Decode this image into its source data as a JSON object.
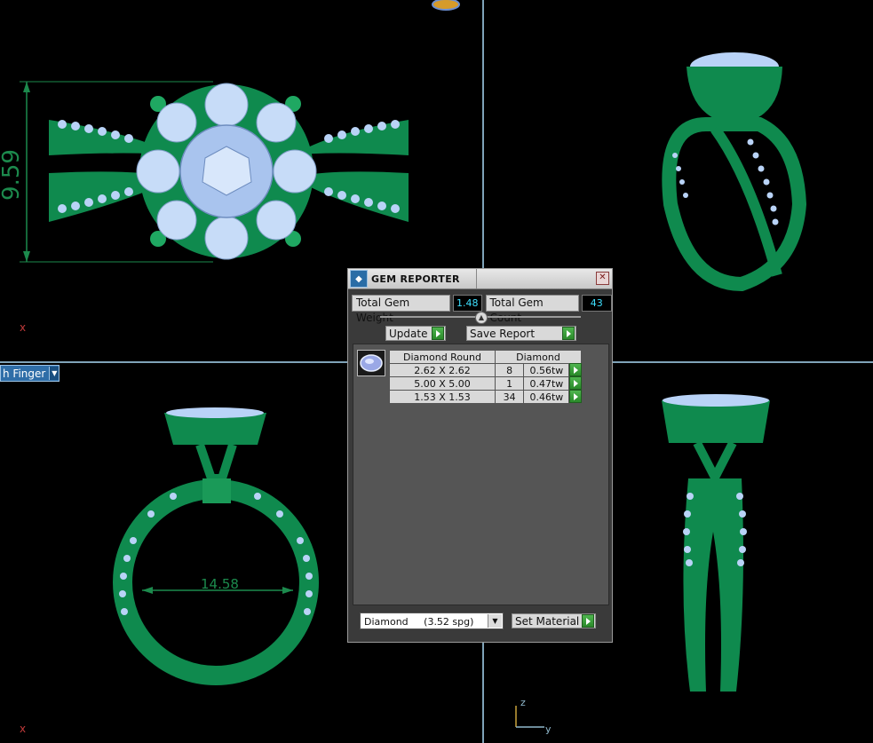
{
  "viewport": {
    "front_dimension": "9.59",
    "side_dimension": "14.58",
    "finger_selector": "h Finger",
    "axis_x": "x",
    "axis_z": "z",
    "axis_y": "y"
  },
  "panel": {
    "title": "GEM REPORTER",
    "total_weight_label": "Total Gem Weight",
    "total_weight_value": "1.48",
    "total_count_label": "Total Gem Count",
    "total_count_value": "43",
    "update_label": "Update",
    "save_report_label": "Save Report",
    "table_headers": [
      "Diamond Round",
      "Diamond"
    ],
    "rows": [
      {
        "size": "2.62 X 2.62",
        "count": "8",
        "weight": "0.56tw"
      },
      {
        "size": "5.00 X 5.00",
        "count": "1",
        "weight": "0.47tw"
      },
      {
        "size": "1.53 X 1.53",
        "count": "34",
        "weight": "0.46tw"
      }
    ],
    "material_value": "Diamond     (3.52 spg)",
    "set_material_label": "Set Material"
  },
  "colors": {
    "metal": "#0f8a4e",
    "gem": "#b9d3f7",
    "divider": "#7fa3b8"
  }
}
